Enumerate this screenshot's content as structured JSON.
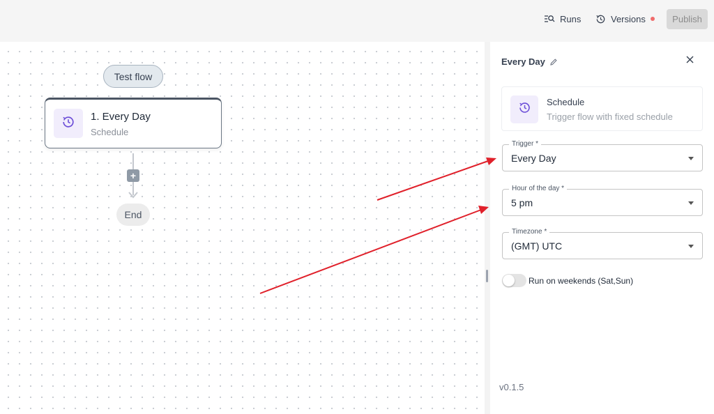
{
  "header": {
    "runs_label": "Runs",
    "versions_label": "Versions",
    "publish_label": "Publish",
    "accent_dot_color": "#f06b6b"
  },
  "canvas": {
    "test_flow_label": "Test flow",
    "step": {
      "title": "1. Every Day",
      "subtitle": "Schedule",
      "icon": "clock-icon"
    },
    "end_label": "End"
  },
  "panel": {
    "title": "Every Day",
    "summary": {
      "title": "Schedule",
      "description": "Trigger flow with fixed schedule"
    },
    "fields": [
      {
        "label": "Trigger *",
        "value": "Every Day"
      },
      {
        "label": "Hour of the day *",
        "value": "5 pm"
      },
      {
        "label": "Timezone *",
        "value": "(GMT) UTC"
      }
    ],
    "weekend_toggle": {
      "label": "Run on weekends (Sat,Sun)",
      "checked": false
    },
    "version": "v0.1.5"
  },
  "colors": {
    "icon_accent": "#6d4fd8",
    "annotation_arrow": "#e0202a"
  }
}
